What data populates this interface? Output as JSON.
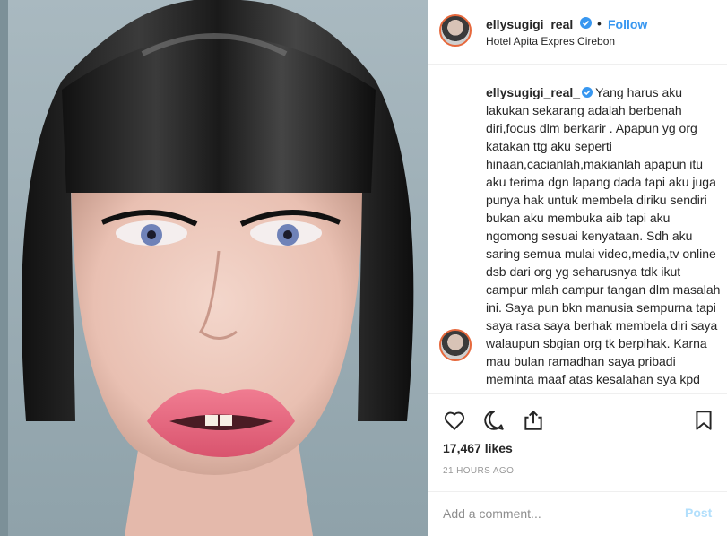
{
  "post": {
    "username": "ellysugigi_real_",
    "follow_label": "Follow",
    "separator": "•",
    "location": "Hotel Apita Expres Cirebon",
    "caption": "Yang harus aku lakukan sekarang adalah berbenah diri,focus dlm berkarir . Apapun yg org katakan ttg aku seperti hinaan,cacianlah,makianlah apapun itu aku terima dgn lapang dada tapi aku juga punya hak untuk membela diriku sendiri bukan aku membuka aib tapi aku ngomong sesuai kenyataan. Sdh aku saring semua mulai video,media,tv online dsb dari org yg seharusnya tdk ikut campur mlah campur tangan dlm masalah ini. Saya pun bkn manusia sempurna tapi saya rasa saya berhak membela diri saya walaupun sbgian org tk berpihak. Karna mau bulan ramadhan saya pribadi meminta maaf atas kesalahan sya kpd",
    "likes": "17,467 likes",
    "time": "21 HOURS AGO"
  },
  "comment": {
    "placeholder": "Add a comment...",
    "post_label": "Post"
  },
  "icons": {
    "verified": "verified-badge-icon",
    "like": "heart-icon",
    "comment": "comment-bubble-icon",
    "share": "share-icon",
    "save": "bookmark-icon"
  },
  "colors": {
    "accent": "#3897f0",
    "verified": "#3897f0",
    "post_disabled": "#b2dffc",
    "divider": "#efefef"
  }
}
